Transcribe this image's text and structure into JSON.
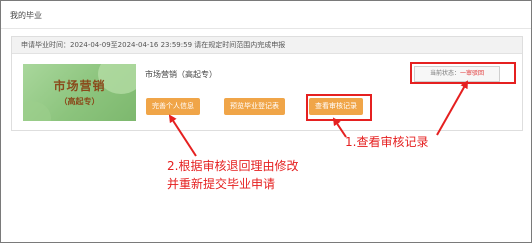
{
  "page": {
    "title": "我的毕业"
  },
  "notice": {
    "text": "申请毕业时间：2024-04-09至2024-04-16 23:59:59 请在规定时间范围内完成申报"
  },
  "graduation_item": {
    "thumbnail": {
      "name": "市场营销",
      "level": "（高起专）"
    },
    "major": "市场营销（高起专）",
    "buttons": {
      "complete_info": "完善个人信息",
      "preview_register": "预览毕业登记表",
      "view_review": "查看审核记录"
    },
    "status": {
      "label": "当前状态：",
      "value": "一审驳回"
    }
  },
  "annotations": {
    "step1": "1.查看审核记录",
    "step2_line1": "2.根据审核退回理由修改",
    "step2_line2": "并重新提交毕业申请"
  },
  "colors": {
    "button": "#f0a548",
    "highlight": "#e52020",
    "status_value": "#e03030"
  }
}
